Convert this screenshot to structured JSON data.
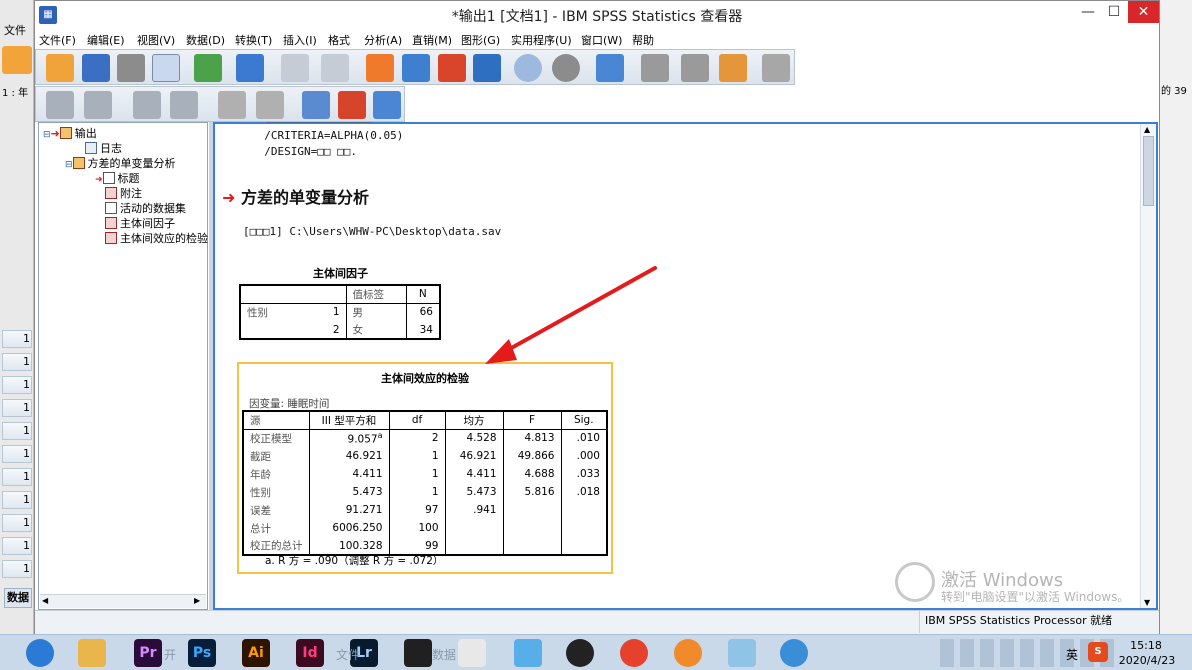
{
  "window": {
    "title": "*输出1 [文档1] - IBM SPSS Statistics 查看器",
    "min": "—",
    "max": "☐",
    "close": "✕"
  },
  "background": {
    "file_menu": "文件",
    "sheet_ref": "1 : 年",
    "right_label": "的 39",
    "row_labels": [
      "1",
      "1",
      "1",
      "1",
      "1",
      "1",
      "1",
      "1",
      "1",
      "1",
      "1"
    ],
    "data_tab": "数据"
  },
  "menu": [
    "文件(F)",
    "编辑(E)",
    "视图(V)",
    "数据(D)",
    "转换(T)",
    "插入(I)",
    "格式",
    "分析(A)",
    "直销(M)",
    "图形(G)",
    "实用程序(U)",
    "窗口(W)",
    "帮助"
  ],
  "outline": {
    "root": "输出",
    "items": [
      "日志",
      "方差的单变量分析",
      "标题",
      "附注",
      "活动的数据集",
      "主体间因子",
      "主体间效应的检验"
    ]
  },
  "syntax": {
    "line1": "  /CRITERIA=ALPHA(0.05)",
    "line2": "  /DESIGN=□□ □□."
  },
  "section_title": "方差的单变量分析",
  "dataset_path": "[□□□1] C:\\Users\\WHW-PC\\Desktop\\data.sav",
  "factors": {
    "title": "主体间因子",
    "header_value": "值标签",
    "header_n": "N",
    "var": "性别",
    "rows": [
      {
        "code": "1",
        "label": "男",
        "n": "66"
      },
      {
        "code": "2",
        "label": "女",
        "n": "34"
      }
    ]
  },
  "anova": {
    "title": "主体间效应的检验",
    "dependent": "因变量: 睡眠时间",
    "headers": [
      "源",
      "III 型平方和",
      "df",
      "均方",
      "F",
      "Sig."
    ],
    "rows": [
      {
        "source": "校正模型",
        "ss": "9.057",
        "sup": "a",
        "df": "2",
        "ms": "4.528",
        "f": "4.813",
        "sig": ".010"
      },
      {
        "source": "截距",
        "ss": "46.921",
        "sup": "",
        "df": "1",
        "ms": "46.921",
        "f": "49.866",
        "sig": ".000"
      },
      {
        "source": "年龄",
        "ss": "4.411",
        "sup": "",
        "df": "1",
        "ms": "4.411",
        "f": "4.688",
        "sig": ".033"
      },
      {
        "source": "性别",
        "ss": "5.473",
        "sup": "",
        "df": "1",
        "ms": "5.473",
        "f": "5.816",
        "sig": ".018"
      },
      {
        "source": "误差",
        "ss": "91.271",
        "sup": "",
        "df": "97",
        "ms": ".941",
        "f": "",
        "sig": ""
      },
      {
        "source": "总计",
        "ss": "6006.250",
        "sup": "",
        "df": "100",
        "ms": "",
        "f": "",
        "sig": ""
      },
      {
        "source": "校正的总计",
        "ss": "100.328",
        "sup": "",
        "df": "99",
        "ms": "",
        "f": "",
        "sig": ""
      }
    ],
    "footnote": "a. R 方 = .090（调整 R 方 = .072）"
  },
  "watermark": {
    "line1": "激活 Windows",
    "line2": "转到\"电脑设置\"以激活 Windows。"
  },
  "status": "IBM SPSS Statistics Processor 就绪",
  "taskbar": {
    "time": "15:18",
    "date": "2020/4/23",
    "ime": "英",
    "apps": [
      "Pr",
      "Ps",
      "Ai",
      "Id",
      "Lr"
    ],
    "faded_1": "开",
    "faded_2": "文件",
    "faded_3": "数据"
  },
  "colors": {
    "accent": "#3c7fd6",
    "arrow": "#e31b1b",
    "highlight": "#f5c242"
  }
}
